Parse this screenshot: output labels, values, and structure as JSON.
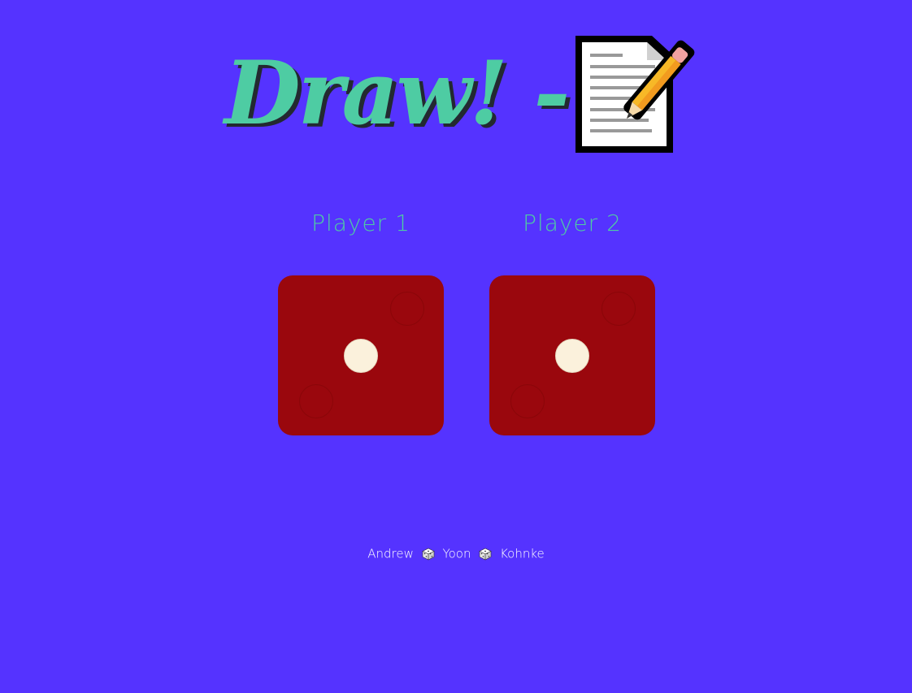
{
  "header": {
    "title": "Draw! -",
    "title_icon": "memo-icon"
  },
  "players": [
    {
      "label": "Player 1",
      "die_value": 1
    },
    {
      "label": "Player 2",
      "die_value": 1
    }
  ],
  "footer": {
    "names": [
      "Andrew",
      "Yoon",
      "Kohnke"
    ],
    "separator_icon": "die-icon"
  },
  "colors": {
    "background": "#5533ff",
    "accent": "#4ecca3",
    "dice": "#9a070d",
    "pip": "#fbf1dc"
  }
}
